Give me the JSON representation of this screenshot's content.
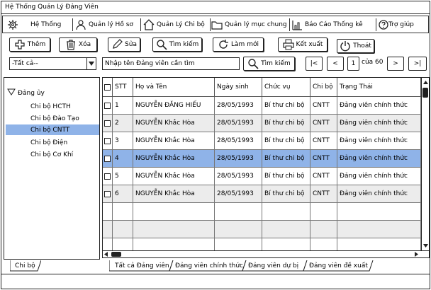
{
  "window": {
    "title": "Hệ Thống Quản Lý Đảng Viên"
  },
  "menu": [
    {
      "label": "Hệ Thống",
      "icon": "gear-icon"
    },
    {
      "label": "Quản lý Hồ sơ",
      "icon": "user-icon"
    },
    {
      "label": "Quản Lý Chi bộ",
      "icon": "home-icon"
    },
    {
      "label": "Quản lý mục chung",
      "icon": "folder-icon"
    },
    {
      "label": "Báo Cáo Thống kê",
      "icon": "bar-chart-icon"
    },
    {
      "label": "Trợ giúp",
      "icon": "help-icon"
    }
  ],
  "toolbar": {
    "add": "Thêm",
    "delete": "Xóa",
    "edit": "Sửa",
    "search": "Tìm kiếm",
    "refresh": "Làm mới",
    "export": "Kết xuất",
    "exit": "Thoát"
  },
  "filter": {
    "dropdown_value": "-Tất cả--",
    "search_placeholder": "Nhập tên Đảng viên cần tìm",
    "search_button": "Tìm kiếm"
  },
  "pagination": {
    "first": "|<",
    "prev": "<",
    "current": "1",
    "of_label": "của 60",
    "next": ">",
    "last": ">|"
  },
  "tree": {
    "root": "Đảng ủy",
    "children": [
      "Chi bộ HCTH",
      "Chi bộ Đào Tạo",
      "Chi bộ CNTT",
      "Chi bộ Điện",
      "Chi bộ Cơ Khí"
    ],
    "selected_index": 2
  },
  "table": {
    "headers": [
      "",
      "STT",
      "Họ và Tên",
      "Ngày sinh",
      "Chức vụ",
      "Chi bộ",
      "Trạng Thái"
    ],
    "rows": [
      {
        "stt": "1",
        "name": "NGUYỄN ĐĂNG HIẾU",
        "dob": "28/05/1993",
        "role": "Bí thư chi bộ",
        "branch": "CNTT",
        "status": "Đảng viên chính thức"
      },
      {
        "stt": "2",
        "name": "NGUYỄN Khắc Hòa",
        "dob": "28/05/1993",
        "role": "Bí thư chi bộ",
        "branch": "CNTT",
        "status": "Đảng viên chính thức"
      },
      {
        "stt": "3",
        "name": "NGUYỄN Khắc Hòa",
        "dob": "28/05/1993",
        "role": "Bí thư chi bộ",
        "branch": "CNTT",
        "status": "Đảng viên chính thức"
      },
      {
        "stt": "4",
        "name": "NGUYỄN Khắc Hòa",
        "dob": "28/05/1993",
        "role": "Bí thư chi bộ",
        "branch": "CNTT",
        "status": "Đảng viên chính thức"
      },
      {
        "stt": "5",
        "name": "NGUYỄN Khắc Hòa",
        "dob": "28/05/1993",
        "role": "Bí thư chi bộ",
        "branch": "CNTT",
        "status": "Đảng viên chính thức"
      },
      {
        "stt": "6",
        "name": "NGUYỄN Khắc Hòa",
        "dob": "28/05/1993",
        "role": "Bí thư chi bộ",
        "branch": "CNTT",
        "status": "Đảng viên chính thức"
      }
    ],
    "selected_row": 3
  },
  "left_tab": "Chi bộ",
  "bottom_tabs": [
    "Tất cả Đảng viên",
    "Đảng viên chính thức",
    "Đảng viên dự bị",
    "Đảng viên đề xuất"
  ],
  "colors": {
    "selection": "#8fb3e8",
    "alt_row": "#ececec"
  }
}
